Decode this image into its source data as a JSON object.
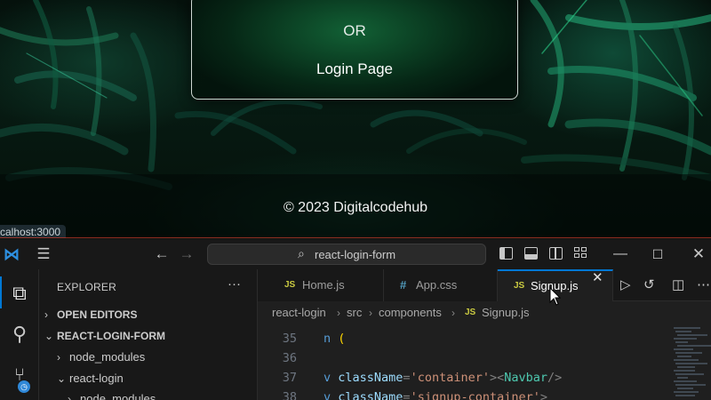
{
  "browser": {
    "login_card": {
      "or_text": "OR",
      "login_link": "Login Page"
    },
    "footer": {
      "copyright": "© 2023 Digitalcodehub"
    },
    "status_url": "calhost:3000"
  },
  "vscode": {
    "titlebar": {
      "search_text": "react-login-form",
      "icons": [
        "vscode-logo",
        "menu-icon",
        "back-arrow",
        "forward-arrow",
        "search-icon",
        "toggle-sidebar",
        "toggle-panel",
        "toggle-secondary-sidebar",
        "customize-layout",
        "minimize",
        "maximize",
        "close"
      ]
    },
    "sidebar": {
      "title": "EXPLORER",
      "more": "···",
      "items": [
        {
          "chevron": "›",
          "label": "OPEN EDITORS"
        },
        {
          "chevron": "⌄",
          "label": "REACT-LOGIN-FORM"
        },
        {
          "chevron": "›",
          "label": "node_modules"
        },
        {
          "chevron": "⌄",
          "label": "react-login"
        },
        {
          "chevron": "›",
          "label": "node_modules"
        }
      ]
    },
    "tabs": [
      {
        "icon": "JS",
        "label": "Home.js"
      },
      {
        "icon": "#",
        "label": "App.css"
      },
      {
        "icon": "JS",
        "label": "Signup.js"
      }
    ],
    "breadcrumb": {
      "part1": "react-login",
      "part2": "src",
      "part3": "components",
      "file_icon": "JS",
      "file": "Signup.js"
    },
    "code": {
      "lines": [
        {
          "no": "35",
          "parts": [
            [
              "n ",
              "kw"
            ],
            [
              "(",
              "paren"
            ]
          ]
        },
        {
          "no": "36",
          "parts": []
        },
        {
          "no": "37",
          "parts": [
            [
              "v ",
              "kw"
            ],
            [
              "className",
              "attr"
            ],
            [
              "=",
              "punc"
            ],
            [
              "'container'",
              "str"
            ],
            [
              "><",
              "punc"
            ],
            [
              "Navbar",
              "tag"
            ],
            [
              "/>",
              "punc"
            ]
          ]
        },
        {
          "no": "38",
          "parts": [
            [
              "v ",
              "kw"
            ],
            [
              "className",
              "attr"
            ],
            [
              "=",
              "punc"
            ],
            [
              "'signup-container'",
              "str"
            ],
            [
              ">",
              "punc"
            ]
          ]
        }
      ]
    },
    "colors": {
      "accent": "#0078d4",
      "js_icon": "#cbcb41",
      "css_icon": "#519aba",
      "string": "#ce9178",
      "attr": "#9cdcfe"
    }
  }
}
